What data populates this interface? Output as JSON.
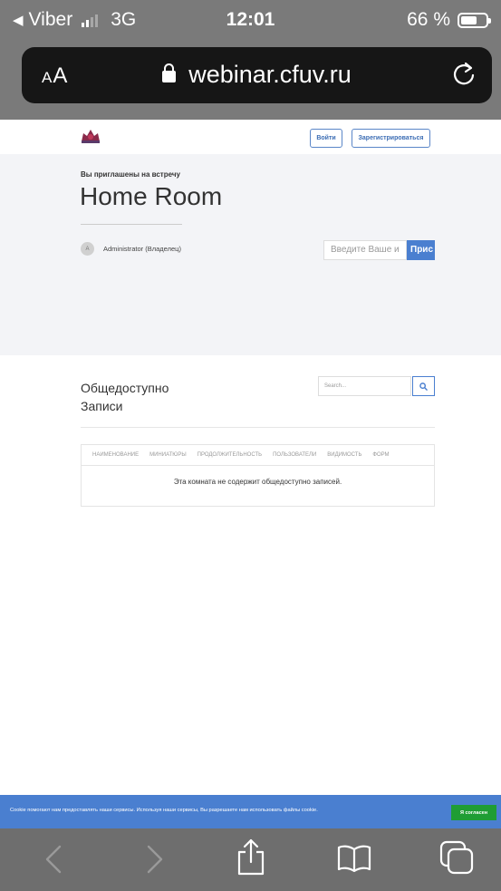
{
  "status_bar": {
    "back_app": "Viber",
    "network": "3G",
    "time": "12:01",
    "battery": "66 %",
    "battery_level": 0.66
  },
  "browser": {
    "text_size_label_small": "A",
    "text_size_label_large": "A",
    "url": "webinar.cfuv.ru"
  },
  "header": {
    "login_label": "Войти",
    "register_label": "Зарегистрироваться"
  },
  "room": {
    "invited_text": "Вы приглашены на встречу",
    "title": "Home Room",
    "owner_initial": "A",
    "owner_name": "Administrator (Владелец)",
    "name_placeholder": "Введите Ваше и",
    "join_label": "Прис"
  },
  "recordings": {
    "title": "Общедоступно Записи",
    "search_placeholder": "Search...",
    "columns": [
      "НАИМЕНОВАНИЕ",
      "МИНИАТЮРЫ",
      "ПРОДОЛЖИТЕЛЬНОСТЬ",
      "ПОЛЬЗОВАТЕЛИ",
      "ВИДИМОСТЬ",
      "ФОРМ"
    ],
    "empty_text": "Эта комната не содержит общедоступно записей."
  },
  "cookie": {
    "text": "Cookie помогают нам предоставлять наши сервисы. Используя наши сервисы, Вы разрешаете нам использовать файлы cookie.",
    "accept_label": "Я согласен"
  },
  "colors": {
    "accent": "#4a7fd0",
    "accept": "#1f9d34"
  }
}
